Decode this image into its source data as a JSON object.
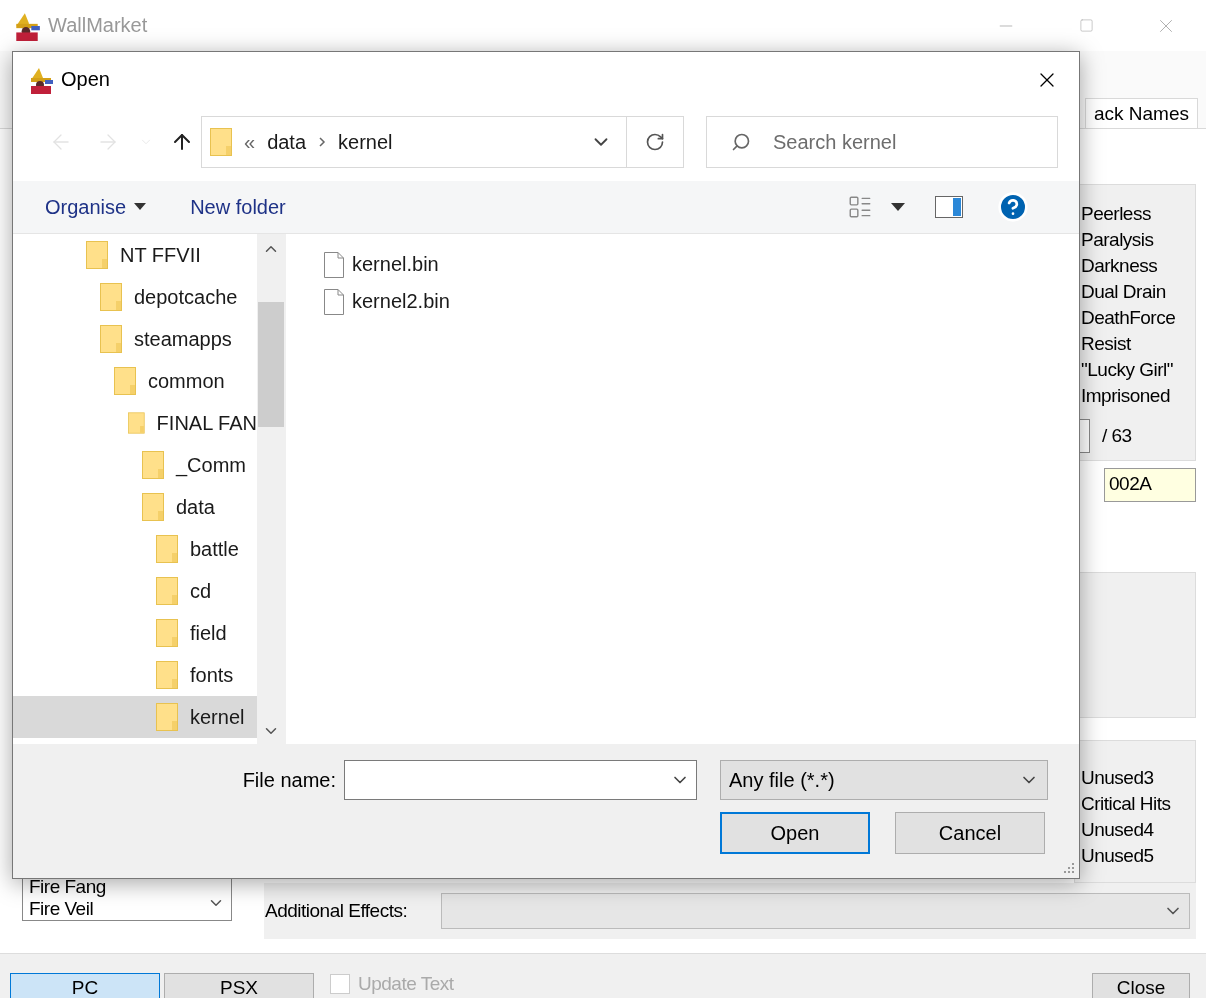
{
  "app": {
    "title": "WallMarket",
    "tab_label": "ack Names",
    "status_effects": [
      "Peerless",
      "Paralysis",
      "Darkness",
      "Dual Drain",
      "DeathForce",
      "Resist",
      "\"Lucky Girl\"",
      "Imprisoned"
    ],
    "max_label": "/ 63",
    "hex_value": "002A",
    "flags": [
      "Unused3",
      "Critical Hits",
      "Unused4",
      "Unused5"
    ],
    "item_list": [
      "Fire Fang",
      "Fire Veil"
    ],
    "additional_effects_label": "Additional Effects:",
    "platform_buttons": [
      {
        "label": "PC",
        "selected": true
      },
      {
        "label": "PSX",
        "selected": false
      }
    ],
    "update_text": {
      "label": "Update Text",
      "checked": false,
      "disabled": true
    },
    "close_button": "Close"
  },
  "dialog": {
    "title": "Open",
    "nav_buttons": [
      {
        "kind": "back",
        "disabled": true
      },
      {
        "kind": "forward",
        "disabled": true
      },
      {
        "kind": "recent",
        "disabled": true
      },
      {
        "kind": "up",
        "disabled": false
      }
    ],
    "breadcrumb_overflow": "«",
    "breadcrumb": [
      "data",
      "kernel"
    ],
    "search": {
      "placeholder": "Search kernel"
    },
    "toolbar": {
      "organise": "Organise",
      "new_folder": "New folder"
    },
    "tree": [
      {
        "label": "NT FFVII",
        "selected": false,
        "children": [
          {
            "label": "depotcache",
            "selected": false
          },
          {
            "label": "steamapps",
            "selected": false,
            "children": [
              {
                "label": "common",
                "selected": false,
                "children": [
                  {
                    "label": "FINAL FAN",
                    "selected": false,
                    "children": [
                      {
                        "label": "_Comm",
                        "selected": false
                      },
                      {
                        "label": "data",
                        "selected": false,
                        "children": [
                          {
                            "label": "battle",
                            "selected": false
                          },
                          {
                            "label": "cd",
                            "selected": false
                          },
                          {
                            "label": "field",
                            "selected": false
                          },
                          {
                            "label": "fonts",
                            "selected": false
                          },
                          {
                            "label": "kernel",
                            "selected": true
                          }
                        ]
                      }
                    ]
                  }
                ]
              }
            ]
          }
        ]
      }
    ],
    "files": [
      "kernel.bin",
      "kernel2.bin"
    ],
    "file_name_label": "File name:",
    "file_type": "Any file (*.*)",
    "buttons": [
      {
        "label": "Open",
        "kind": "default"
      },
      {
        "label": "Cancel",
        "kind": "normal"
      }
    ]
  }
}
